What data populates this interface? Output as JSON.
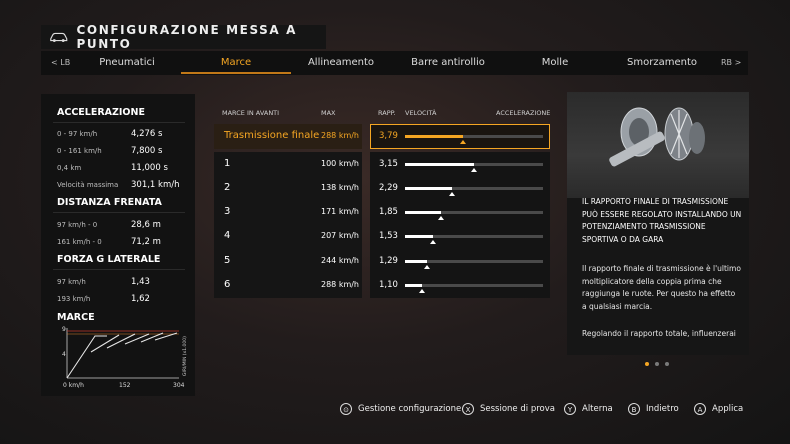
{
  "title": "CONFIGURAZIONE MESSA A PUNTO",
  "tabs": {
    "lb": "< LB",
    "rb": "RB >",
    "items": [
      "Pneumatici",
      "Marce",
      "Allineamento",
      "Barre antirollio",
      "Molle",
      "Smorzamento"
    ],
    "active": "Marce"
  },
  "stats": {
    "acceleration_title": "ACCELERAZIONE",
    "acceleration": [
      {
        "label": "0 - 97 km/h",
        "value": "4,276 s"
      },
      {
        "label": "0 - 161 km/h",
        "value": "7,800 s"
      },
      {
        "label": "0,4 km",
        "value": "11,000 s"
      },
      {
        "label": "Velocità massima",
        "value": "301,1 km/h"
      }
    ],
    "braking_title": "DISTANZA FRENATA",
    "braking": [
      {
        "label": "97 km/h - 0",
        "value": "28,6 m"
      },
      {
        "label": "161 km/h - 0",
        "value": "71,2 m"
      }
    ],
    "gforce_title": "FORZA G LATERALE",
    "gforce": [
      {
        "label": "97 km/h",
        "value": "1,43"
      },
      {
        "label": "193 km/h",
        "value": "1,62"
      }
    ],
    "gears_title": "MARCE",
    "chart": {
      "y_max": "9",
      "y_mid": "4",
      "x_ticks": [
        "0 km/h",
        "152",
        "304"
      ],
      "y_axis_label": "GIRI/MIN (x1.000)"
    }
  },
  "table": {
    "headers": {
      "gear": "MARCE IN AVANTI",
      "max": "MAX",
      "ratio": "RAPP.",
      "speed": "VELOCITÀ",
      "accel": "ACCELERAZIONE"
    },
    "rows": [
      {
        "name": "Trasmissione finale",
        "max": "288 km/h",
        "ratio": "3,79",
        "level": 0.42,
        "selected": true
      },
      {
        "name": "1",
        "max": "100 km/h",
        "ratio": "3,15",
        "level": 0.5,
        "selected": false
      },
      {
        "name": "2",
        "max": "138 km/h",
        "ratio": "2,29",
        "level": 0.34,
        "selected": false
      },
      {
        "name": "3",
        "max": "171 km/h",
        "ratio": "1,85",
        "level": 0.26,
        "selected": false
      },
      {
        "name": "4",
        "max": "207 km/h",
        "ratio": "1,53",
        "level": 0.2,
        "selected": false
      },
      {
        "name": "5",
        "max": "244 km/h",
        "ratio": "1,29",
        "level": 0.16,
        "selected": false
      },
      {
        "name": "6",
        "max": "288 km/h",
        "ratio": "1,10",
        "level": 0.12,
        "selected": false
      }
    ]
  },
  "info": {
    "heading": "IL RAPPORTO FINALE DI TRASMISSIONE PUÒ ESSERE REGOLATO INSTALLANDO UN POTENZIAMENTO TRASMISSIONE SPORTIVA O DA GARA",
    "body": "Il rapporto finale di trasmissione è l'ultimo moltiplicatore della coppia prima che raggiunga le ruote. Per questo ha effetto a qualsiasi marcia.",
    "body2": "Regolando il rapporto totale, influenzerai"
  },
  "footer": [
    {
      "icon": "view-icon",
      "glyph": "⊙",
      "label": "Gestione configurazione"
    },
    {
      "icon": "x-button-icon",
      "glyph": "X",
      "label": "Sessione di prova"
    },
    {
      "icon": "y-button-icon",
      "glyph": "Y",
      "label": "Alterna"
    },
    {
      "icon": "b-button-icon",
      "glyph": "B",
      "label": "Indietro"
    },
    {
      "icon": "a-button-icon",
      "glyph": "A",
      "label": "Applica"
    }
  ],
  "colors": {
    "accent": "#f5a623",
    "panel": "#121212",
    "track": "#4a4a4a"
  }
}
